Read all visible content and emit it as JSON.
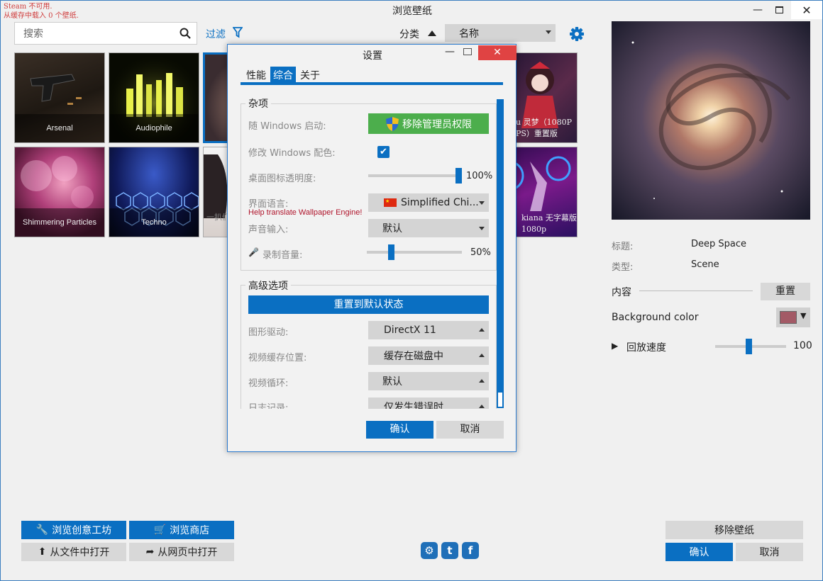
{
  "window": {
    "title": "浏览壁纸",
    "steam_warning_line1": "Steam 不可用.",
    "steam_warning_line2": "从缓存中载入 0 个壁纸."
  },
  "toolbar": {
    "search_placeholder": "搜索",
    "filter_label": "过滤",
    "sort_label": "分类",
    "sort_value": "名称"
  },
  "tiles": [
    {
      "caption": "Arsenal"
    },
    {
      "caption": "Audiophile"
    },
    {
      "caption": "Shimmering Particles"
    },
    {
      "caption": "Techno"
    },
    {
      "caption": "u 灵梦（1080P"
    },
    {
      "caption": "PS）重置版"
    },
    {
      "caption": "kiana 无字幕版"
    },
    {
      "caption": "1080p"
    },
    {
      "caption": "一扒们"
    }
  ],
  "details": {
    "title_label": "标题:",
    "title_value": "Deep Space",
    "type_label": "类型:",
    "type_value": "Scene",
    "content_label": "内容",
    "reset_button": "重置",
    "bgcolor_label": "Background color",
    "bgcolor_value": "#a35a66",
    "playback_label": "回放速度",
    "playback_value": "100",
    "playback_fraction": 0.48
  },
  "bottom": {
    "workshop_button": "浏览创意工坊",
    "store_button": "浏览商店",
    "open_file_button": "从文件中打开",
    "open_web_button": "从网页中打开",
    "remove_button": "移除壁纸",
    "ok_button": "确认",
    "cancel_button": "取消"
  },
  "dialog": {
    "title": "设置",
    "tabs": [
      "性能",
      "综合",
      "关于"
    ],
    "active_tab": "综合",
    "misc_group": "杂项",
    "startup_label": "随 Windows 启动:",
    "startup_button": "移除管理员权限",
    "win_color_label": "修改 Windows 配色:",
    "win_color_checked": true,
    "icon_opacity_label": "桌面图标透明度:",
    "icon_opacity_value": "100%",
    "icon_opacity_fraction": 1.0,
    "language_label": "界面语言:",
    "language_value": "Simplified Chi...",
    "translate_link": "Help translate Wallpaper Engine!",
    "audio_input_label": "声音输入:",
    "audio_input_value": "默认",
    "record_volume_label": "录制音量:",
    "record_volume_value": "50%",
    "record_volume_fraction": 0.25,
    "advanced_group": "高级选项",
    "reset_defaults_button": "重置到默认状态",
    "graphics_label": "图形驱动:",
    "graphics_value": "DirectX 11",
    "video_cache_label": "视频缓存位置:",
    "video_cache_value": "缓存在磁盘中",
    "video_loop_label": "视频循环:",
    "video_loop_value": "默认",
    "log_label": "日志记录:",
    "log_value": "仅发生错误时",
    "ok_button": "确认",
    "cancel_button": "取消"
  },
  "colors": {
    "accent": "#0a6fc2",
    "close_red": "#e04343",
    "green_button": "#4cae4c",
    "link_red": "#b0152c"
  }
}
